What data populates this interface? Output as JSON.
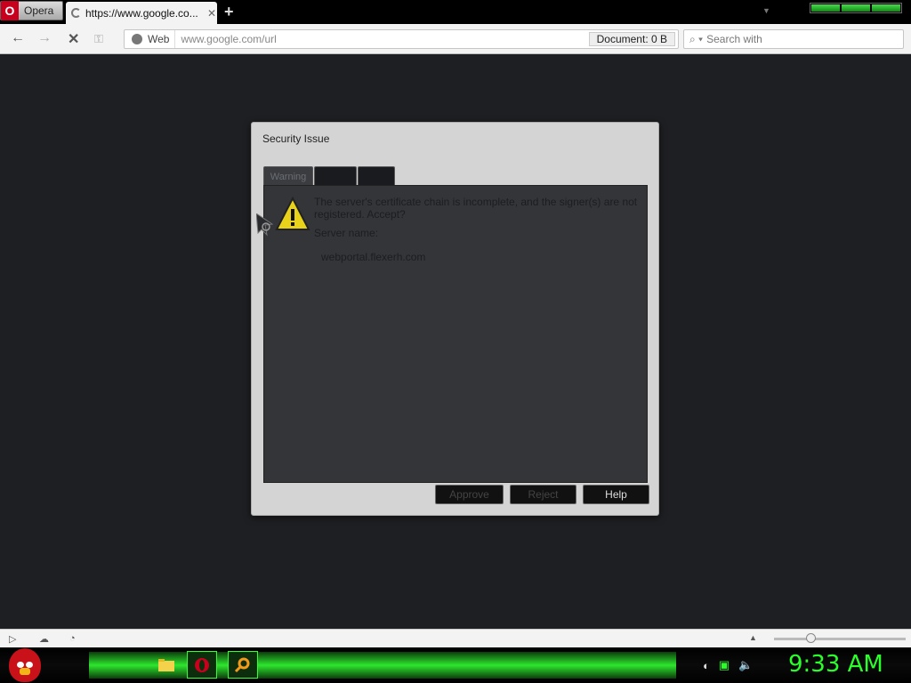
{
  "browser": {
    "menu_label": "Opera",
    "tab_title": "https://www.google.co...",
    "tab_close": "✕",
    "new_tab": "+",
    "addr_badge": "Web",
    "url": "www.google.com/url",
    "document_size": "Document:  0 B",
    "search_placeholder": "Search with"
  },
  "dialog": {
    "title": "Security Issue",
    "tabs": [
      "Warning",
      "",
      ""
    ],
    "message": "The server's certificate chain is incomplete, and the signer(s) are not registered. Accept?",
    "server_label": "Server name:",
    "server_value": "webportal.flexerh.com",
    "buttons": {
      "approve": "Approve",
      "reject": "Reject",
      "help": "Help"
    }
  },
  "taskbar": {
    "clock": "9:33 AM"
  },
  "colors": {
    "accent_green": "#2bff2b",
    "opera_red": "#c8001e"
  }
}
